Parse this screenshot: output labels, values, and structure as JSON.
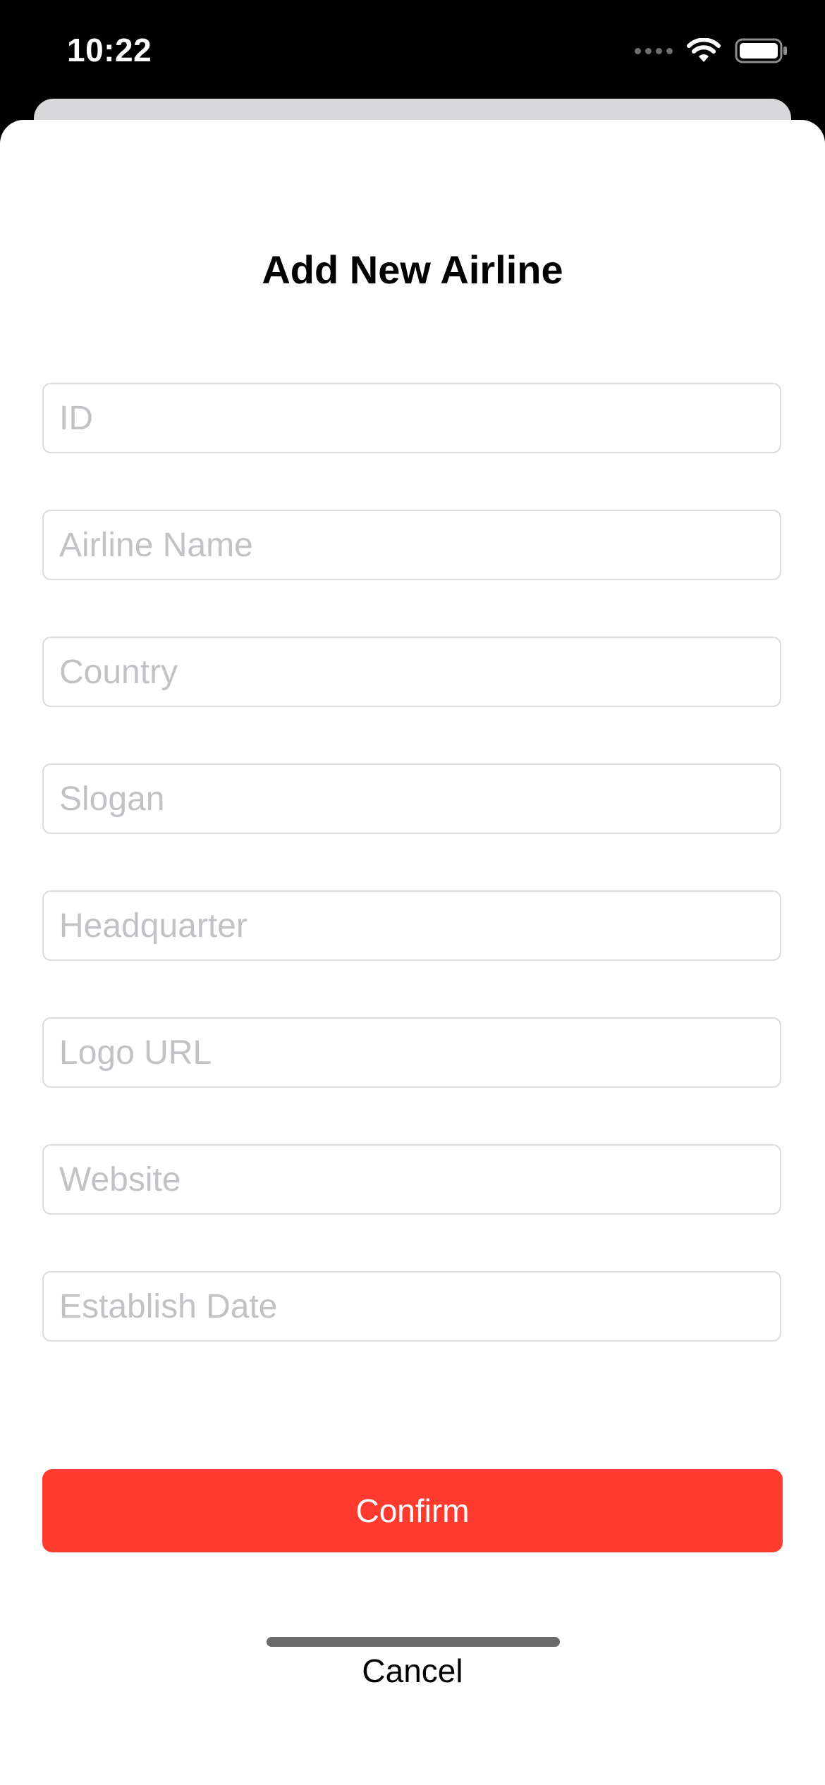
{
  "status_bar": {
    "time": "10:22",
    "icons": [
      "signal-dots-icon",
      "wifi-icon",
      "battery-icon"
    ]
  },
  "sheet": {
    "title": "Add New Airline",
    "fields": [
      {
        "name": "id-field",
        "placeholder": "ID",
        "value": ""
      },
      {
        "name": "airline-name-field",
        "placeholder": "Airline Name",
        "value": ""
      },
      {
        "name": "country-field",
        "placeholder": "Country",
        "value": ""
      },
      {
        "name": "slogan-field",
        "placeholder": "Slogan",
        "value": ""
      },
      {
        "name": "headquarter-field",
        "placeholder": "Headquarter",
        "value": ""
      },
      {
        "name": "logo-url-field",
        "placeholder": "Logo URL",
        "value": ""
      },
      {
        "name": "website-field",
        "placeholder": "Website",
        "value": ""
      },
      {
        "name": "establish-date-field",
        "placeholder": "Establish Date",
        "value": ""
      }
    ],
    "confirm_label": "Confirm",
    "cancel_label": "Cancel"
  },
  "colors": {
    "accent": "#ff3b30",
    "placeholder": "#c2c2c6",
    "field_border": "#dcdcdc"
  }
}
